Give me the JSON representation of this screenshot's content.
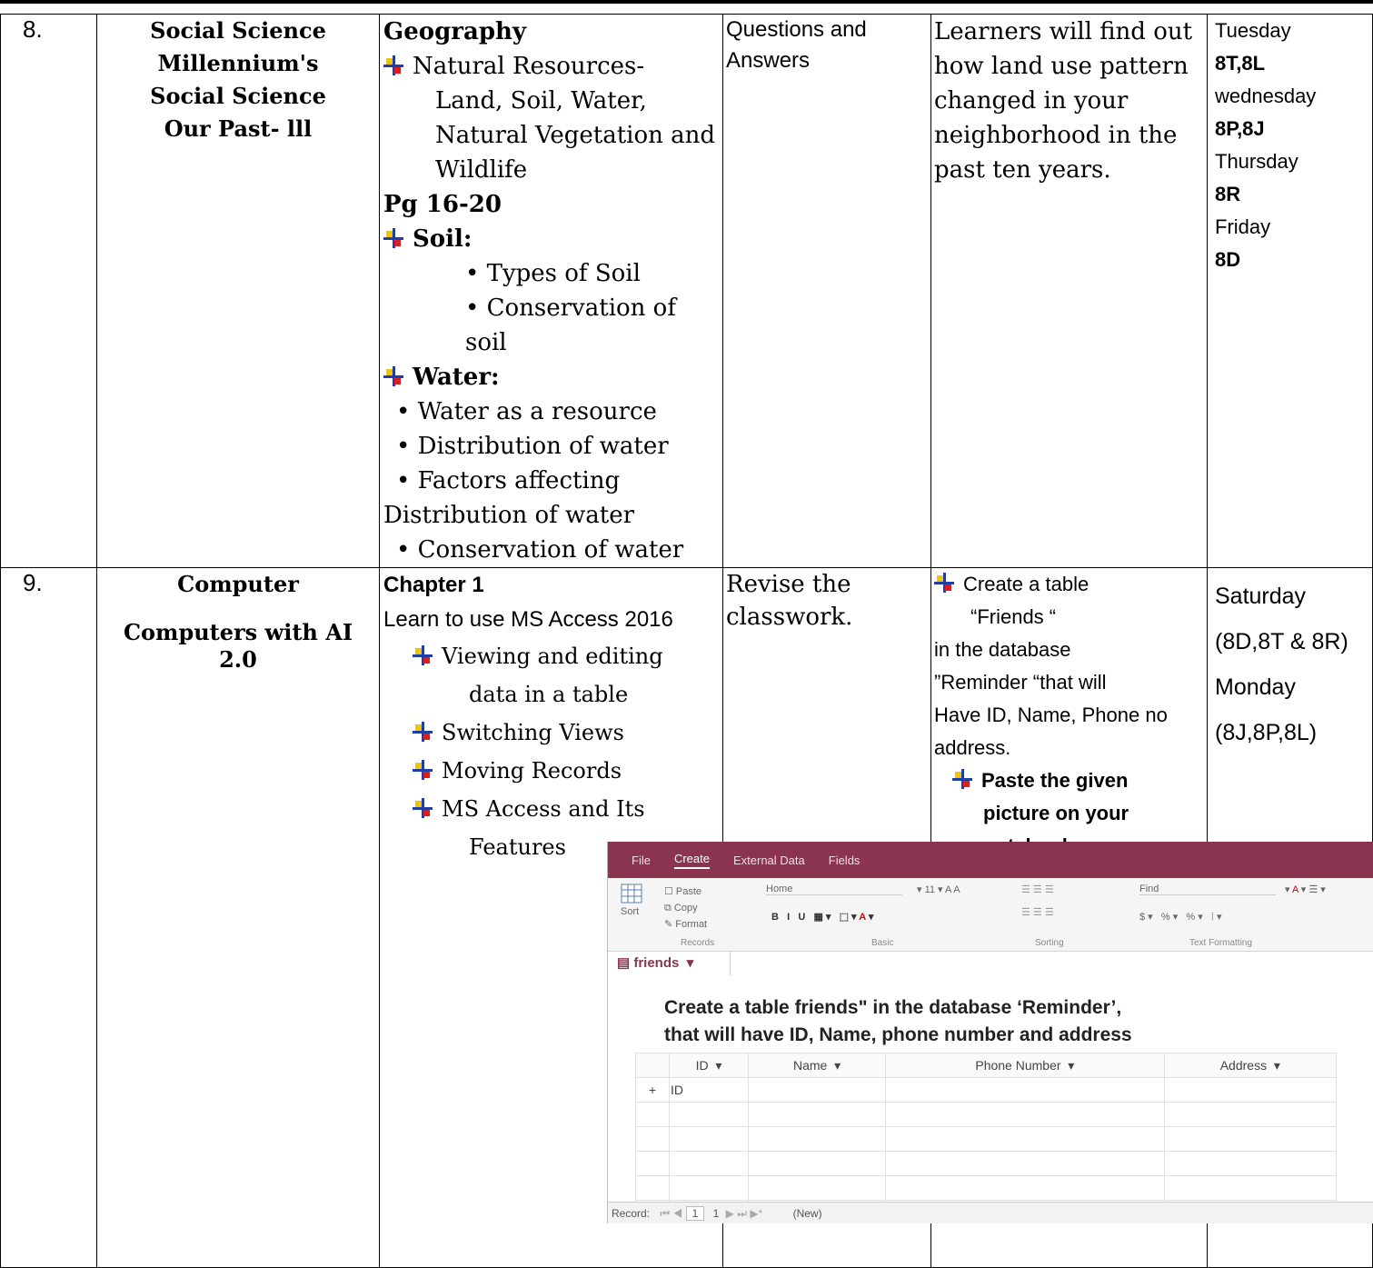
{
  "row8": {
    "num": "8.",
    "subject": [
      "Social Science",
      "Millennium's",
      "Social Science",
      "Our Past- lll"
    ],
    "topic": {
      "heading": "Geography",
      "bullet1": [
        "Natural Resources-",
        "Land, Soil, Water,",
        "Natural Vegetation and",
        "Wildlife"
      ],
      "pages": "Pg 16-20",
      "soil_head": "Soil:",
      "soil_items": [
        "Types of Soil",
        "Conservation of soil"
      ],
      "water_head": "Water:",
      "water_items": [
        "Water as a resource",
        "Distribution of water",
        "Factors affecting"
      ],
      "water_wrap": "Distribution of water",
      "water_last": "Conservation of water"
    },
    "classwork": [
      "Questions and",
      "Answers"
    ],
    "homework": [
      "Learners will find out",
      "how land use pattern",
      "changed in your",
      "neighborhood in the",
      "past ten years."
    ],
    "days": [
      "Tuesday",
      "8T,8L",
      "wednesday",
      "8P,8J",
      "Thursday",
      "8R",
      "Friday",
      "8D"
    ]
  },
  "row9": {
    "num": "9.",
    "subject": [
      "Computer",
      "Computers with AI",
      "2.0"
    ],
    "topic": {
      "heading": "Chapter 1",
      "line": "Learn to use MS Access 2016",
      "items": [
        "Viewing and editing",
        "data in a table",
        "Switching Views",
        "Moving Records",
        "MS Access and Its",
        "Features"
      ]
    },
    "classwork": [
      "Revise the",
      "classwork."
    ],
    "homework": {
      "l1": "Create a table",
      "l2": "“Friends “",
      "l3": "in the database",
      "l4": "”Reminder “that will",
      "l5": "Have ID, Name, Phone no",
      "l6": "address.",
      "p1": "Paste the given",
      "p2": "picture on your",
      "p3": "notebook",
      "p4": "."
    },
    "days": [
      "Saturday",
      "(8D,8T & 8R)",
      "Monday",
      "(8J,8P,8L)"
    ]
  },
  "screenshot": {
    "tabs": [
      "File",
      "Create",
      "External Data",
      "Fields"
    ],
    "records_group": [
      "Paste",
      "Copy",
      "Format"
    ],
    "sort": "Sort",
    "groups": [
      "Records",
      "Basic",
      "Sorting",
      "Text Formatting"
    ],
    "font_name": "Home",
    "font_size": "11",
    "find": "Find",
    "object_tab": "friends",
    "caption": [
      "Create a table friends\" in the database ‘Reminder’,",
      "that will have ID, Name, phone number and address"
    ],
    "columns": [
      "ID",
      "Name",
      "Phone Number",
      "Address"
    ],
    "first_row": "ID",
    "record_label": "Record:",
    "record_pos": "1",
    "record_of": "1",
    "new_label": "(New)"
  }
}
